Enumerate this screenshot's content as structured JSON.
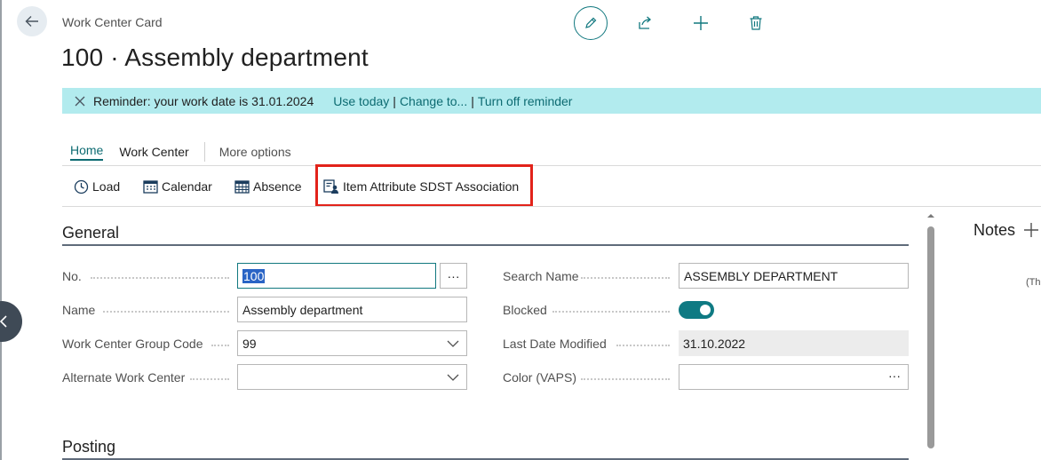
{
  "header": {
    "caption": "Work Center Card",
    "title": "100 · Assembly department"
  },
  "reminder": {
    "text": "Reminder: your work date is 31.01.2024",
    "use_today": "Use today",
    "change_to": "Change to...",
    "turn_off": "Turn off reminder",
    "separator": "|"
  },
  "tabs": {
    "home": "Home",
    "work_center": "Work Center",
    "more_options": "More options"
  },
  "actions": {
    "load": "Load",
    "calendar": "Calendar",
    "absence": "Absence",
    "item_attribute": "Item Attribute SDST Association"
  },
  "general": {
    "title": "General",
    "no_label": "No.",
    "no_value": "100",
    "assist_edit": "···",
    "name_label": "Name",
    "name_value": "Assembly department",
    "wcgroup_label": "Work Center Group Code",
    "wcgroup_value": "99",
    "alt_label": "Alternate Work Center",
    "alt_value": "",
    "search_label": "Search Name",
    "search_value": "ASSEMBLY DEPARTMENT",
    "blocked_label": "Blocked",
    "blocked_value": true,
    "lastmod_label": "Last Date Modified",
    "lastmod_value": "31.10.2022",
    "color_label": "Color (VAPS)",
    "color_value": "",
    "color_assist": "···"
  },
  "posting": {
    "title": "Posting"
  },
  "notes": {
    "title": "Notes",
    "hint": "(Th"
  },
  "colors": {
    "accent": "#11787f",
    "reminder_bg": "#b2ebee",
    "highlight": "#e2231a"
  }
}
